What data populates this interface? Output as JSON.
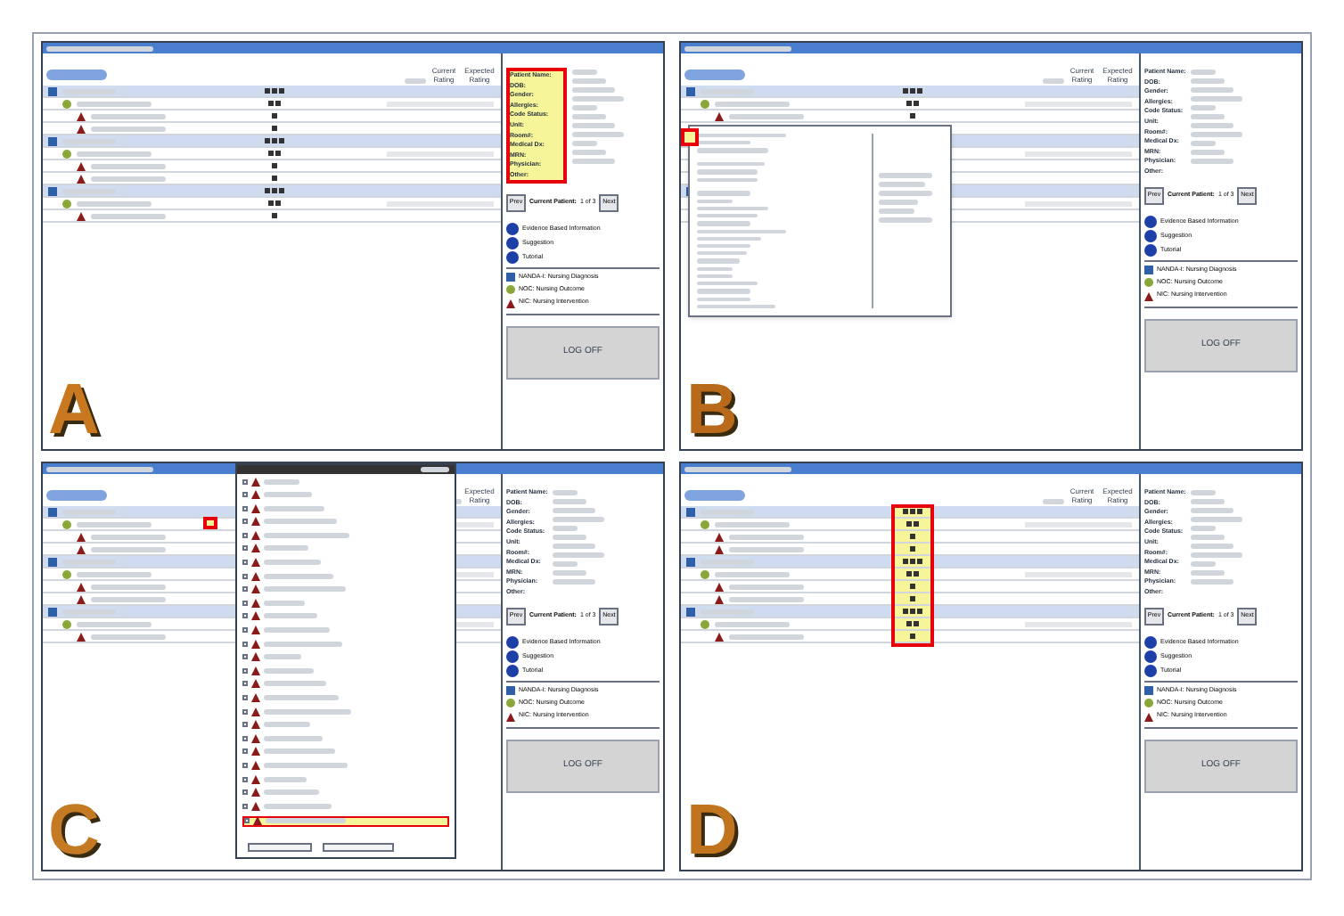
{
  "panels": [
    {
      "letter": "A",
      "kind": "patient_info",
      "columns": [
        "Current Rating",
        "Expected Rating"
      ],
      "patient_labels": [
        "Patient Name:",
        "DOB:",
        "Gender:",
        "Allergies:",
        "Code Status:",
        "Unit:",
        "Room#:",
        "Medical Dx:",
        "MRN:",
        "Physician:",
        "Other:"
      ],
      "navigation": {
        "prev": "Prev",
        "label": "Current Patient:",
        "count": "1 of 3",
        "next": "Next"
      },
      "help_legend": [
        {
          "kind": "info",
          "label": "Evidence Based Information"
        },
        {
          "kind": "info",
          "label": "Suggestion"
        },
        {
          "kind": "info",
          "label": "Tutorial"
        }
      ],
      "type_legend": [
        {
          "kind": "diagnosis",
          "label": "NANDA-I: Nursing Diagnosis"
        },
        {
          "kind": "outcome",
          "label": "NOC: Nursing Outcome"
        },
        {
          "kind": "intervention",
          "label": "NIC: Nursing Intervention"
        }
      ],
      "logoff": "LOG OFF"
    },
    {
      "letter": "B",
      "kind": "popup",
      "columns": [
        "Current Rating",
        "Expected Rating"
      ],
      "patient_labels": [
        "Patient Name:",
        "DOB:",
        "Gender:",
        "Allergies:",
        "Code Status:",
        "Unit:",
        "Room#:",
        "Medical Dx:",
        "MRN:",
        "Physician:",
        "Other:"
      ],
      "navigation": {
        "prev": "Prev",
        "label": "Current Patient:",
        "count": "1 of 3",
        "next": "Next"
      },
      "help_legend": [
        {
          "kind": "info",
          "label": "Evidence Based Information"
        },
        {
          "kind": "info",
          "label": "Suggestion"
        },
        {
          "kind": "info",
          "label": "Tutorial"
        }
      ],
      "type_legend": [
        {
          "kind": "diagnosis",
          "label": "NANDA-I: Nursing Diagnosis"
        },
        {
          "kind": "outcome",
          "label": "NOC: Nursing Outcome"
        },
        {
          "kind": "intervention",
          "label": "NIC: Nursing Intervention"
        }
      ],
      "logoff": "LOG OFF"
    },
    {
      "letter": "C",
      "kind": "dropdown",
      "columns": [
        "Expected Rating"
      ],
      "patient_labels": [
        "Patient Name:",
        "DOB:",
        "Gender:",
        "Allergies:",
        "Code Status:",
        "Unit:",
        "Room#:",
        "Medical Dx:",
        "MRN:",
        "Physician:",
        "Other:"
      ],
      "navigation": {
        "prev": "Prev",
        "label": "Current Patient:",
        "count": "1 of 3",
        "next": "Next"
      },
      "help_legend": [
        {
          "kind": "info",
          "label": "Evidence Based Information"
        },
        {
          "kind": "info",
          "label": "Suggestion"
        },
        {
          "kind": "info",
          "label": "Tutorial"
        }
      ],
      "type_legend": [
        {
          "kind": "diagnosis",
          "label": "NANDA-I: Nursing Diagnosis"
        },
        {
          "kind": "outcome",
          "label": "NOC: Nursing Outcome"
        },
        {
          "kind": "intervention",
          "label": "NIC: Nursing Intervention"
        }
      ],
      "logoff": "LOG OFF",
      "dropdown_items": [
        {
          "checked": false,
          "selected": false
        },
        {
          "checked": false,
          "selected": false
        },
        {
          "checked": false,
          "selected": false
        },
        {
          "checked": false,
          "selected": false
        },
        {
          "checked": false,
          "selected": false
        },
        {
          "checked": false,
          "selected": false
        },
        {
          "checked": false,
          "selected": false
        },
        {
          "checked": false,
          "selected": false
        },
        {
          "checked": false,
          "selected": false
        },
        {
          "checked": false,
          "selected": false
        },
        {
          "checked": false,
          "selected": false
        },
        {
          "checked": false,
          "selected": false
        },
        {
          "checked": false,
          "selected": false
        },
        {
          "checked": false,
          "selected": false
        },
        {
          "checked": false,
          "selected": false
        },
        {
          "checked": false,
          "selected": false
        },
        {
          "checked": false,
          "selected": false
        },
        {
          "checked": false,
          "selected": false
        },
        {
          "checked": false,
          "selected": false
        },
        {
          "checked": false,
          "selected": false
        },
        {
          "checked": false,
          "selected": false
        },
        {
          "checked": false,
          "selected": false
        },
        {
          "checked": false,
          "selected": false
        },
        {
          "checked": false,
          "selected": false
        },
        {
          "checked": false,
          "selected": false
        },
        {
          "checked": false,
          "selected": true
        }
      ]
    },
    {
      "letter": "D",
      "kind": "icon_column",
      "columns": [
        "Current Rating",
        "Expected Rating"
      ],
      "patient_labels": [
        "Patient Name:",
        "DOB:",
        "Gender:",
        "Allergies:",
        "Code Status:",
        "Unit:",
        "Room#:",
        "Medical Dx:",
        "MRN:",
        "Physician:",
        "Other:"
      ],
      "navigation": {
        "prev": "Prev",
        "label": "Current Patient:",
        "count": "1 of 3",
        "next": "Next"
      },
      "help_legend": [
        {
          "kind": "info",
          "label": "Evidence Based Information"
        },
        {
          "kind": "info",
          "label": "Suggestion"
        },
        {
          "kind": "info",
          "label": "Tutorial"
        }
      ],
      "type_legend": [
        {
          "kind": "diagnosis",
          "label": "NANDA-I: Nursing Diagnosis"
        },
        {
          "kind": "outcome",
          "label": "NOC: Nursing Outcome"
        },
        {
          "kind": "intervention",
          "label": "NIC: Nursing Intervention"
        }
      ],
      "logoff": "LOG OFF"
    }
  ],
  "tree": [
    {
      "kind": "diagnosis",
      "children": [
        {
          "kind": "outcome",
          "children": [
            {
              "kind": "intervention"
            },
            {
              "kind": "intervention"
            }
          ]
        }
      ]
    },
    {
      "kind": "diagnosis",
      "children": [
        {
          "kind": "outcome",
          "children": [
            {
              "kind": "intervention"
            },
            {
              "kind": "intervention"
            }
          ]
        }
      ]
    },
    {
      "kind": "diagnosis",
      "children": [
        {
          "kind": "outcome",
          "children": [
            {
              "kind": "intervention"
            }
          ]
        }
      ]
    }
  ]
}
